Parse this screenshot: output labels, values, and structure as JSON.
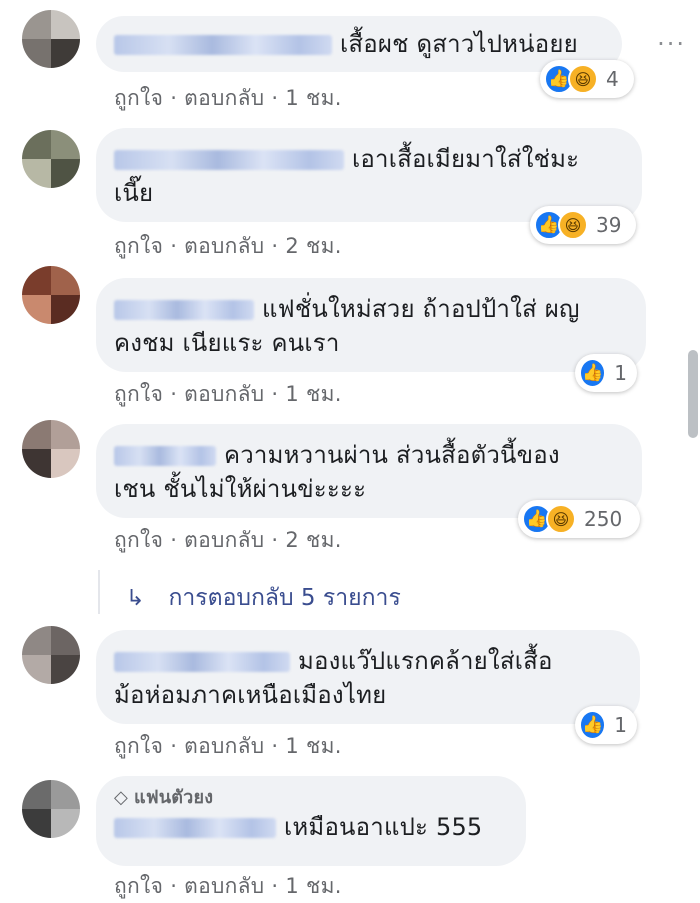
{
  "comments": [
    {
      "text": "เสื้อผช ดูสาวไปหน่อยย",
      "actions": {
        "like": "ถูกใจ",
        "reply": "ตอบกลับ",
        "time": "1 ชม."
      },
      "reactions": {
        "types": [
          "like",
          "haha"
        ],
        "count": "4"
      }
    },
    {
      "text": "เอาเสื้อเมียมาใส่ใช่มะ\nเนี๊ย",
      "actions": {
        "like": "ถูกใจ",
        "reply": "ตอบกลับ",
        "time": "2 ชม."
      },
      "reactions": {
        "types": [
          "like",
          "haha"
        ],
        "count": "39"
      }
    },
    {
      "text": "แฟชั่นใหม่สวย ถ้าอปป้าใส่ ผญ\nคงชม เนียแระ คนเรา",
      "actions": {
        "like": "ถูกใจ",
        "reply": "ตอบกลับ",
        "time": "1 ชม."
      },
      "reactions": {
        "types": [
          "like"
        ],
        "count": "1"
      }
    },
    {
      "text": "ความหวานผ่าน ส่วนสื้อตัวนี้ของ\nเชน ชั้นไม่ให้ผ่านข่ะะะะ",
      "actions": {
        "like": "ถูกใจ",
        "reply": "ตอบกลับ",
        "time": "2 ชม."
      },
      "reactions": {
        "types": [
          "like",
          "haha"
        ],
        "count": "250"
      }
    },
    {
      "text": "มองแว๊ปแรกคล้ายใส่เสื้อ\nม้อห่อมภาคเหนือเมืองไทย",
      "actions": {
        "like": "ถูกใจ",
        "reply": "ตอบกลับ",
        "time": "1 ชม."
      },
      "reactions": {
        "types": [
          "like"
        ],
        "count": "1"
      }
    },
    {
      "badge": "แฟนตัวยง",
      "text": "เหมือนอาแปะ 555",
      "actions": {
        "like": "ถูกใจ",
        "reply": "ตอบกลับ",
        "time": "1 ชม."
      }
    }
  ],
  "replies_link": "การตอบกลับ 5 รายการ",
  "separator": "·",
  "more_label": "···",
  "icons": {
    "like": "thumbs-up-icon",
    "haha": "laugh-icon",
    "reply_arrow": "reply-arrow-icon",
    "badge": "diamond-icon"
  },
  "colors": {
    "bubble": "#f0f2f5",
    "meta": "#65676b",
    "like": "#1877f2",
    "haha": "#f7b125",
    "link": "#3a4d8f"
  }
}
